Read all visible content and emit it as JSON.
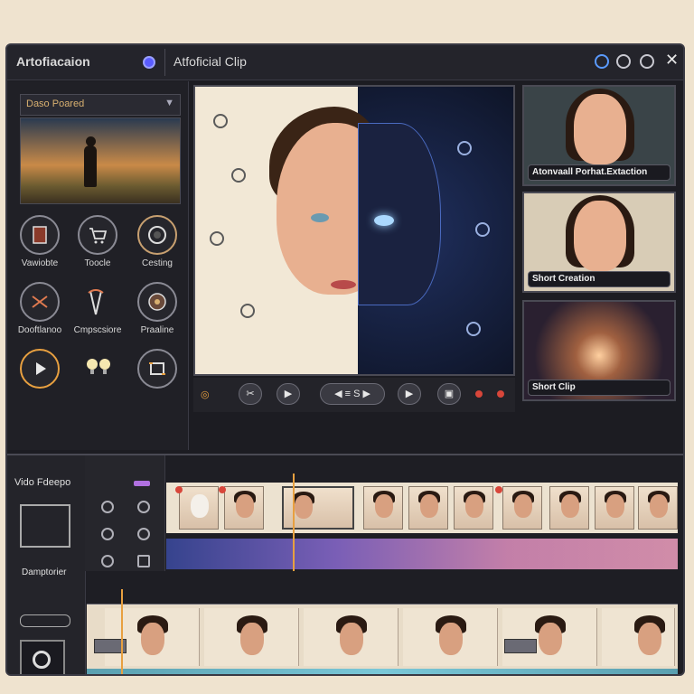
{
  "app": {
    "name": "Artofiacaion",
    "doc_title": "Atfoficial Clip"
  },
  "source_panel": {
    "dropdown_value": "Daso Poared"
  },
  "tools": [
    {
      "label": "Vawiobte",
      "icon": "book-icon"
    },
    {
      "label": "Toocle",
      "icon": "cart-icon"
    },
    {
      "label": "Cesting",
      "icon": "lens-icon"
    },
    {
      "label": "Dooftlanoo",
      "icon": "scissors-icon"
    },
    {
      "label": "Cmpscsiore",
      "icon": "cut-icon"
    },
    {
      "label": "Praaline",
      "icon": "dial-icon"
    },
    {
      "label": "",
      "icon": "play-icon"
    },
    {
      "label": "",
      "icon": "bulb-icon"
    },
    {
      "label": "",
      "icon": "crop-icon"
    }
  ],
  "player": {
    "pill_label": "◀ ≡ S ▶"
  },
  "cards": [
    {
      "label": "Atonvaall Porhat.Extaction"
    },
    {
      "label": "Short Creation"
    },
    {
      "label": "Short Clip"
    }
  ],
  "timeline": {
    "panel_title": "Vido Fdeepo",
    "panel_sub": "Damptorier"
  },
  "colors": {
    "accent": "#e8a040",
    "record": "#d8463a",
    "ai_blue": "#9ad0ff"
  }
}
